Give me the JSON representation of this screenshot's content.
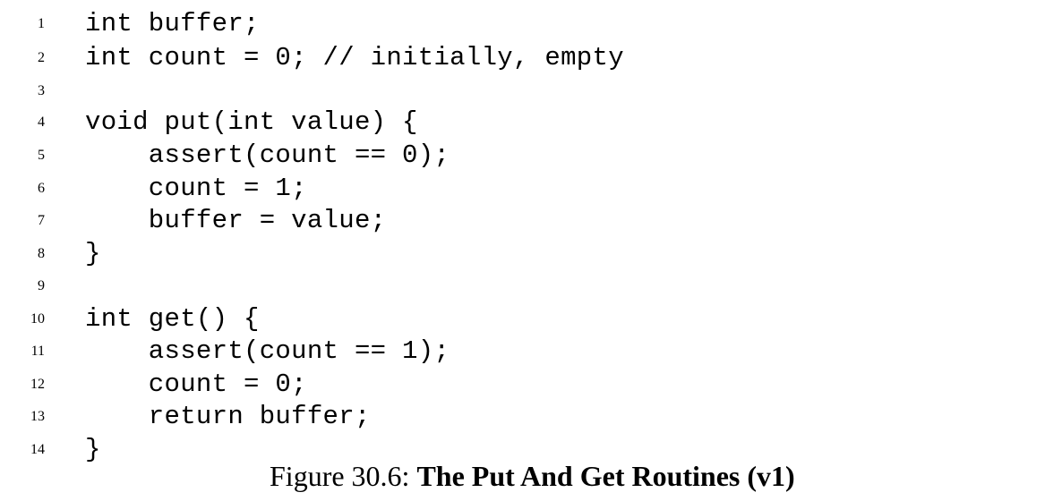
{
  "lines": [
    {
      "num": "1",
      "code": "int buffer;"
    },
    {
      "num": "2",
      "code": "int count = 0; // initially, empty"
    },
    {
      "num": "3",
      "code": ""
    },
    {
      "num": "4",
      "code": "void put(int value) {"
    },
    {
      "num": "5",
      "code": "    assert(count == 0);"
    },
    {
      "num": "6",
      "code": "    count = 1;"
    },
    {
      "num": "7",
      "code": "    buffer = value;"
    },
    {
      "num": "8",
      "code": "}"
    },
    {
      "num": "9",
      "code": ""
    },
    {
      "num": "10",
      "code": "int get() {"
    },
    {
      "num": "11",
      "code": "    assert(count == 1);"
    },
    {
      "num": "12",
      "code": "    count = 0;"
    },
    {
      "num": "13",
      "code": "    return buffer;"
    },
    {
      "num": "14",
      "code": "}"
    }
  ],
  "caption": {
    "label": "Figure 30.6: ",
    "title": "The Put And Get Routines (v1)"
  }
}
